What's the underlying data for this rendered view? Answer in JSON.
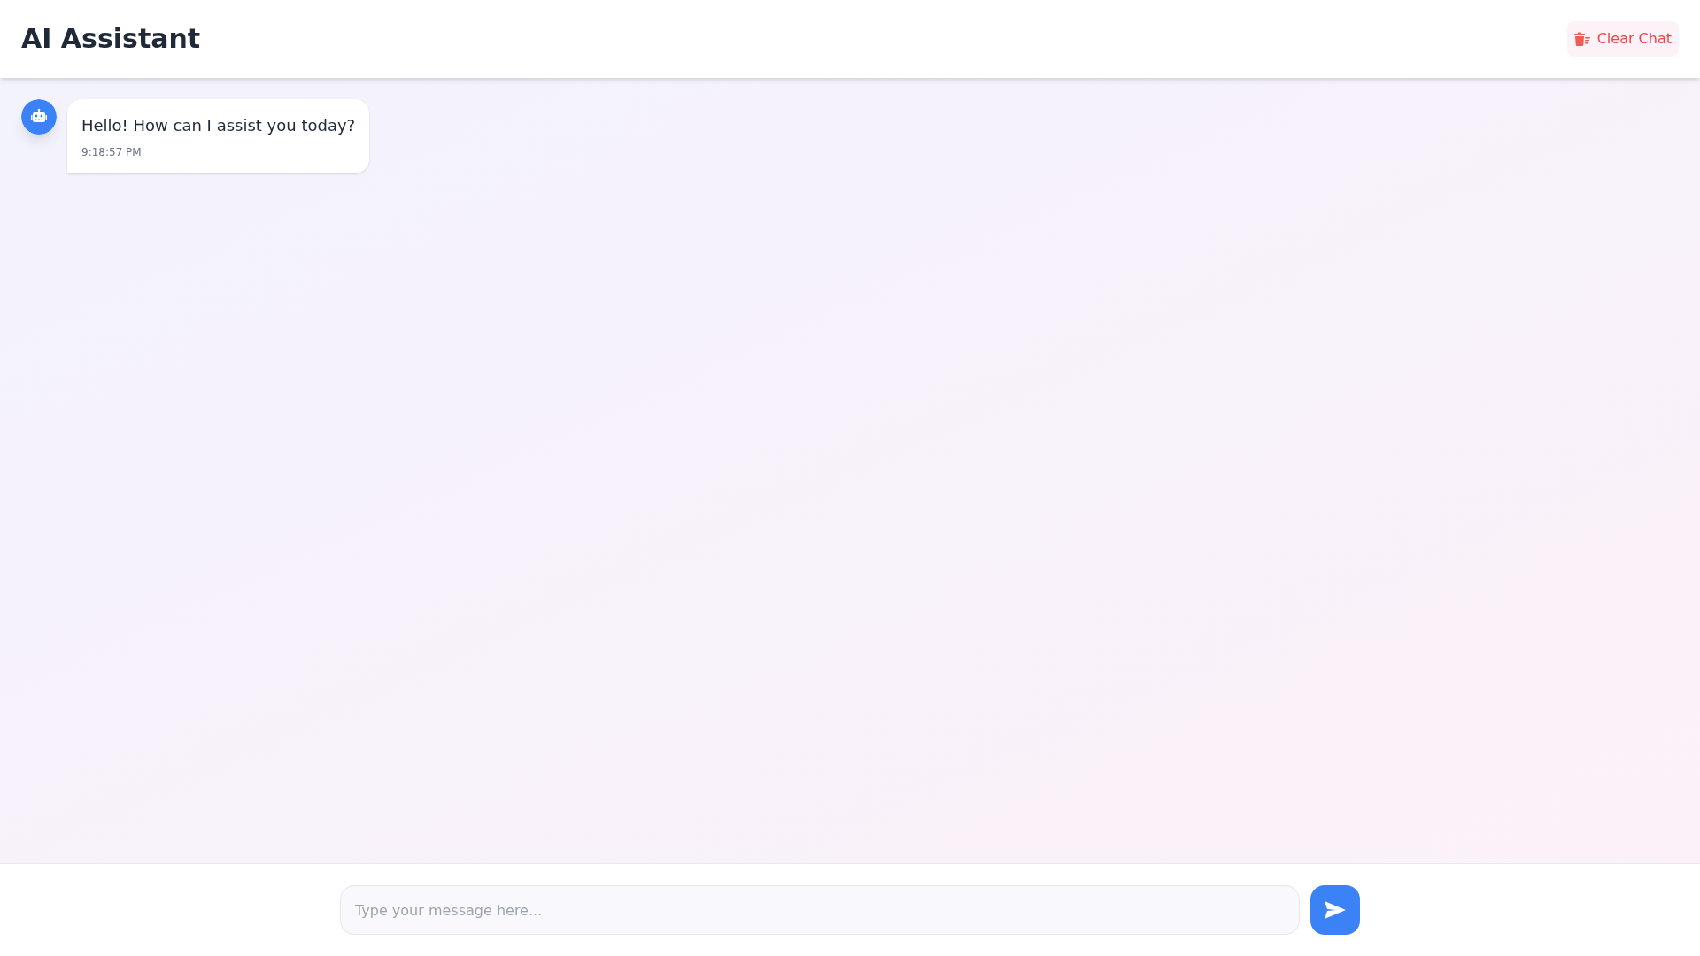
{
  "header": {
    "title": "AI Assistant",
    "clear_button": {
      "label": "Clear Chat"
    }
  },
  "messages": [
    {
      "kind": "assistant",
      "text": "Hello! How can I assist you today?",
      "time": "9:18:57 PM"
    }
  ],
  "composer": {
    "placeholder": "Type your message here..."
  }
}
